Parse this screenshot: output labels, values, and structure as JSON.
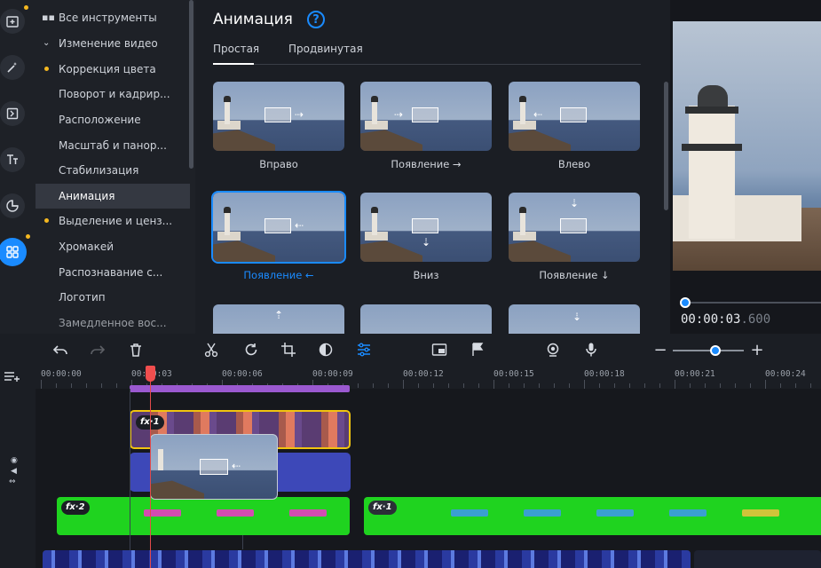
{
  "rail": {
    "icons": [
      "add-media-icon",
      "magic-wand-icon",
      "transitions-icon",
      "text-icon",
      "stickers-icon",
      "more-tools-icon"
    ]
  },
  "categories": {
    "items": [
      {
        "label": "Все инструменты",
        "marker": "grid"
      },
      {
        "label": "Изменение видео",
        "marker": "chevron"
      },
      {
        "label": "Коррекция цвета",
        "marker": "dot"
      },
      {
        "label": "Поворот и кадрир...",
        "marker": ""
      },
      {
        "label": "Расположение",
        "marker": ""
      },
      {
        "label": "Масштаб и панор...",
        "marker": ""
      },
      {
        "label": "Стабилизация",
        "marker": ""
      },
      {
        "label": "Анимация",
        "marker": "",
        "active": true
      },
      {
        "label": "Выделение и ценз...",
        "marker": "dot"
      },
      {
        "label": "Хромакей",
        "marker": ""
      },
      {
        "label": "Распознавание с...",
        "marker": ""
      },
      {
        "label": "Логотип",
        "marker": ""
      },
      {
        "label": "Замедленное вос...",
        "marker": ""
      }
    ]
  },
  "panel": {
    "title": "Анимация",
    "help": "?",
    "tabs": {
      "simple": "Простая",
      "advanced": "Продвинутая"
    },
    "tiles": [
      {
        "label": "Вправо"
      },
      {
        "label": "Появление →"
      },
      {
        "label": "Влево"
      },
      {
        "label": "Появление ←",
        "selected": true
      },
      {
        "label": "Вниз"
      },
      {
        "label": "Появление ↓"
      }
    ]
  },
  "preview": {
    "time_main": "00:00:03",
    "time_frac": ".600"
  },
  "toolbar": {
    "zoom_minus": "−",
    "zoom_plus": "+",
    "zoom_level": 0.6
  },
  "timeline": {
    "ticks": [
      "00:00:00",
      "00:00:03",
      "00:00:06",
      "00:00:09",
      "00:00:12",
      "00:00:15",
      "00:00:18",
      "00:00:21",
      "00:00:24"
    ],
    "fx_top": "fx·1",
    "fx_green1": "fx·2",
    "fx_green2": "fx·1"
  },
  "colors": {
    "accent": "#1a8bff",
    "highlight_dot": "#f5b820",
    "clip_selected_border": "#f1c40f",
    "green_clip": "#1fd31f",
    "purple_track": "#9b59d0",
    "playhead": "#f04e4e"
  }
}
